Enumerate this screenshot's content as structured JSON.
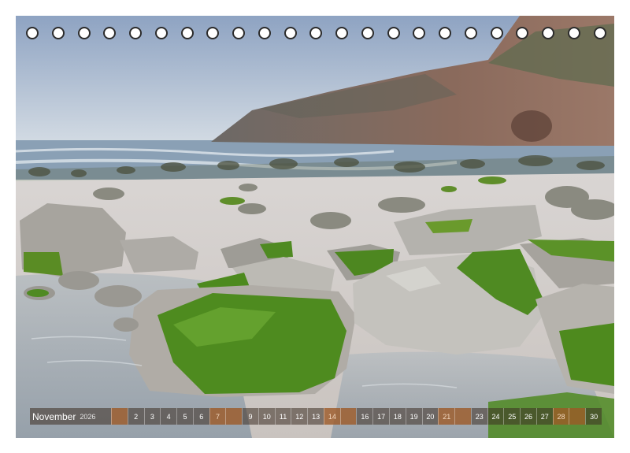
{
  "calendar": {
    "month": "November",
    "year": "2026",
    "days": [
      {
        "label": "",
        "weekend": true
      },
      {
        "label": "2",
        "weekend": false
      },
      {
        "label": "3",
        "weekend": false
      },
      {
        "label": "4",
        "weekend": false
      },
      {
        "label": "5",
        "weekend": false
      },
      {
        "label": "6",
        "weekend": false
      },
      {
        "label": "7",
        "weekend": true
      },
      {
        "label": "",
        "weekend": true
      },
      {
        "label": "9",
        "weekend": false
      },
      {
        "label": "10",
        "weekend": false
      },
      {
        "label": "11",
        "weekend": false
      },
      {
        "label": "12",
        "weekend": false
      },
      {
        "label": "13",
        "weekend": false
      },
      {
        "label": "14",
        "weekend": true
      },
      {
        "label": "",
        "weekend": true
      },
      {
        "label": "16",
        "weekend": false
      },
      {
        "label": "17",
        "weekend": false
      },
      {
        "label": "18",
        "weekend": false
      },
      {
        "label": "19",
        "weekend": false
      },
      {
        "label": "20",
        "weekend": false
      },
      {
        "label": "21",
        "weekend": true
      },
      {
        "label": "",
        "weekend": true
      },
      {
        "label": "23",
        "weekend": false
      },
      {
        "label": "24",
        "weekend": false
      },
      {
        "label": "25",
        "weekend": false
      },
      {
        "label": "26",
        "weekend": false
      },
      {
        "label": "27",
        "weekend": false
      },
      {
        "label": "28",
        "weekend": true
      },
      {
        "label": "",
        "weekend": true
      },
      {
        "label": "30",
        "weekend": false
      }
    ]
  },
  "binding": {
    "hole_count": 23
  },
  "colors": {
    "sky_top": "#8ea3c2",
    "sky_bottom": "#cfd8e2",
    "sea": "#8aa0b5",
    "sand": "#ddd8d4",
    "cliff": "#7a6a62",
    "rock": "#b9b6b0",
    "moss": "#4f8a22",
    "water": "#a9b4bc",
    "weekend": "#c86e28"
  }
}
